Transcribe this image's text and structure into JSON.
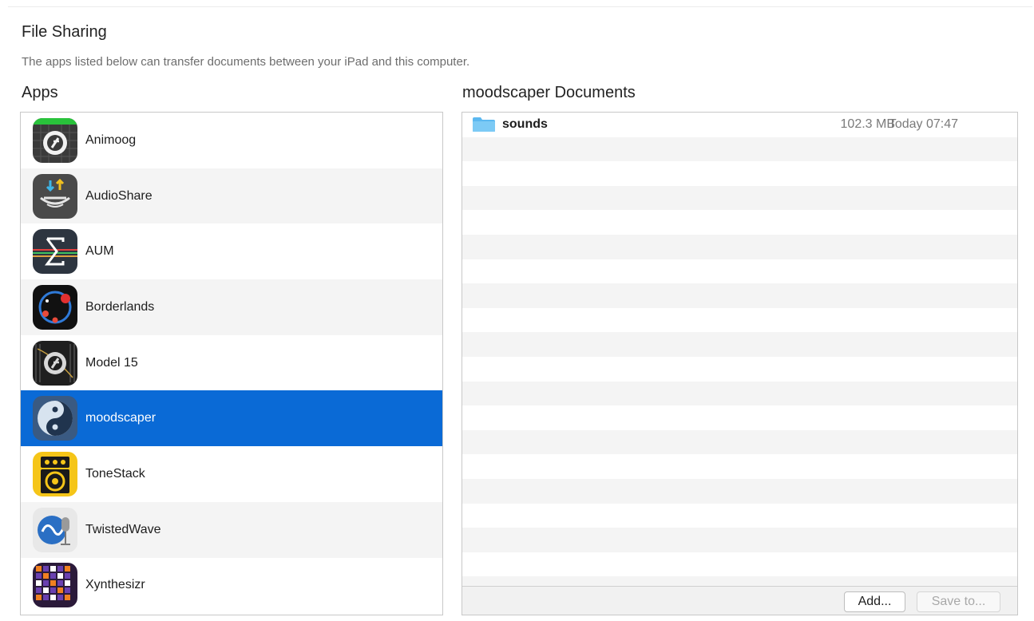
{
  "section": {
    "title": "File Sharing",
    "subtitle": "The apps listed below can transfer documents between your iPad and this computer."
  },
  "apps": {
    "heading": "Apps",
    "items": [
      {
        "label": "Animoog",
        "icon": "animoog-icon"
      },
      {
        "label": "AudioShare",
        "icon": "audioshare-icon"
      },
      {
        "label": "AUM",
        "icon": "aum-icon"
      },
      {
        "label": "Borderlands",
        "icon": "borderlands-icon"
      },
      {
        "label": "Model 15",
        "icon": "model15-icon"
      },
      {
        "label": "moodscaper",
        "icon": "moodscaper-icon",
        "selected": true
      },
      {
        "label": "ToneStack",
        "icon": "tonestack-icon"
      },
      {
        "label": "TwistedWave",
        "icon": "twistedwave-icon"
      },
      {
        "label": "Xynthesizr",
        "icon": "xynthesizr-icon"
      }
    ]
  },
  "documents": {
    "heading": "moodscaper Documents",
    "items": [
      {
        "name": "sounds",
        "size": "102.3 MB",
        "date": "Today 07:47",
        "icon": "folder-icon"
      }
    ],
    "add_label": "Add...",
    "save_label": "Save to..."
  },
  "colors": {
    "selection": "#0a6ad6",
    "folder": "#5bb8f0"
  }
}
